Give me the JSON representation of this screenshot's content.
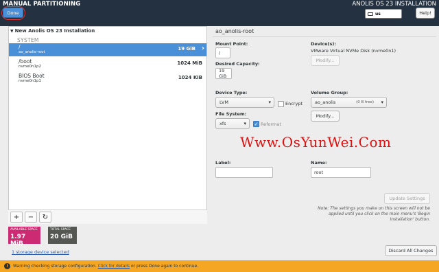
{
  "header": {
    "title": "MANUAL PARTITIONING",
    "done_label": "Done",
    "install_title": "ANOLIS OS 23 INSTALLATION",
    "keyboard_layout": "us",
    "help_label": "Help!"
  },
  "tree": {
    "heading": "New Anolis OS 23 Installation",
    "section": "SYSTEM",
    "partitions": [
      {
        "name": "/",
        "device": "ao_anolis-root",
        "size": "19 GiB"
      },
      {
        "name": "/boot",
        "device": "nvme0n1p2",
        "size": "1024 MiB"
      },
      {
        "name": "BIOS Boot",
        "device": "nvme0n1p1",
        "size": "1024 KiB"
      }
    ],
    "toolbar": {
      "add": "+",
      "remove": "−",
      "refresh": "↻"
    }
  },
  "space": {
    "available_label": "AVAILABLE SPACE",
    "available_value": "1.97 MiB",
    "total_label": "TOTAL SPACE",
    "total_value": "20 GiB",
    "storage_link": "1 storage device selected"
  },
  "detail": {
    "title": "ao_anolis-root",
    "mount_point_label": "Mount Point:",
    "mount_point_value": "/",
    "desired_capacity_label": "Desired Capacity:",
    "desired_capacity_value": "19 GiB",
    "devices_label": "Device(s):",
    "devices_value": "VMware Virtual NVMe Disk (nvme0n1)",
    "modify_label": "Modify...",
    "device_type_label": "Device Type:",
    "device_type_value": "LVM",
    "encrypt_label": "Encrypt",
    "volume_group_label": "Volume Group:",
    "volume_group_value": "ao_anolis",
    "volume_group_free": "(0 B free)",
    "modify_vg_label": "Modify...",
    "file_system_label": "File System:",
    "file_system_value": "xfs",
    "reformat_label": "Reformat",
    "label_label": "Label:",
    "label_value": "",
    "name_label": "Name:",
    "name_value": "root",
    "update_label": "Update Settings",
    "note": "Note:  The settings you make on this screen will not be applied until you click on the main menu's 'Begin Installation' button.",
    "discard_label": "Discard All Changes"
  },
  "watermark": "Www.OsYunWei.Com",
  "warning": {
    "icon": "!",
    "prefix": "Warning checking storage configuration.",
    "link": "Click for details",
    "suffix": "or press Done again to continue."
  },
  "colors": {
    "header": "#233140",
    "selection": "#4a90d9",
    "available": "#cc2a73",
    "total": "#555753",
    "warning": "#f5a623",
    "watermark": "#e01010"
  }
}
